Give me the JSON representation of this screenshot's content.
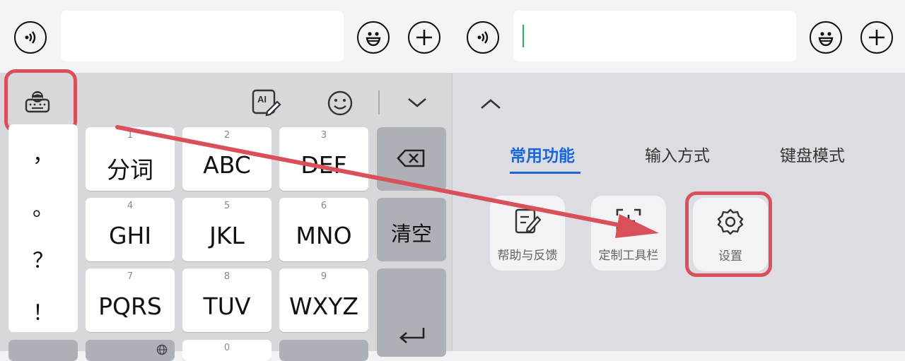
{
  "left_keyboard": {
    "punctuation": [
      "，",
      "。",
      "？",
      "！"
    ],
    "keys": [
      {
        "num": "1",
        "label": "分词"
      },
      {
        "num": "2",
        "label": "ABC"
      },
      {
        "num": "3",
        "label": "DEF"
      },
      {
        "num": "4",
        "label": "GHI"
      },
      {
        "num": "5",
        "label": "JKL"
      },
      {
        "num": "6",
        "label": "MNO"
      },
      {
        "num": "7",
        "label": "PQRS"
      },
      {
        "num": "8",
        "label": "TUV"
      },
      {
        "num": "9",
        "label": "WXYZ"
      },
      {
        "num": "0",
        "label": ""
      }
    ],
    "clear_label": "清空"
  },
  "right_panel": {
    "tabs": [
      "常用功能",
      "输入方式",
      "键盘模式"
    ],
    "active_tab": "常用功能",
    "tools": [
      {
        "label": "帮助与反馈",
        "icon": "edit-note-icon"
      },
      {
        "label": "定制工具栏",
        "icon": "customize-icon"
      },
      {
        "label": "设置",
        "icon": "gear-icon"
      }
    ]
  },
  "colors": {
    "accent": "#1a66d8",
    "highlight": "#d9505a",
    "arrow": "#d9505a",
    "cursor": "#1bb55c"
  }
}
